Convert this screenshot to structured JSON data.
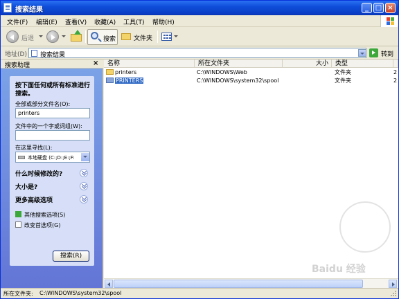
{
  "window": {
    "title": "搜索结果",
    "controls": {
      "minimize": "_",
      "maximize": "□",
      "close": "×"
    }
  },
  "menubar": {
    "items": [
      "文件(F)",
      "编辑(E)",
      "查看(V)",
      "收藏(A)",
      "工具(T)",
      "帮助(H)"
    ]
  },
  "toolbar": {
    "back_label": "后退",
    "search_label": "搜索",
    "folders_label": "文件夹",
    "icons": {
      "back": "back-arrow-icon",
      "forward": "forward-arrow-icon",
      "up": "up-folder-icon",
      "search": "magnifier-icon",
      "folders": "folder-icon",
      "views": "views-grid-icon"
    }
  },
  "address": {
    "label": "地址(D)",
    "value": "搜索结果",
    "go_label": "转到"
  },
  "search_pane": {
    "title": "搜索助理",
    "close": "×",
    "intro": "按下面任何或所有标准进行搜索。",
    "name_label": "全部或部分文件名(O):",
    "name_value": "printers",
    "word_label": "文件中的一个字或词组(W):",
    "word_value": "",
    "look_in_label": "在这里寻找(L):",
    "look_in_value": "本地硬盘 (C:;D:;E:;F:",
    "sections": [
      "什么时候修改的?",
      "大小是?",
      "更多高级选项"
    ],
    "links": [
      "其他搜索选项(S)",
      "改变首选项(G)"
    ],
    "search_button": "搜索(R)"
  },
  "file_list": {
    "columns": [
      "名称",
      "所在文件夹",
      "大小",
      "类型"
    ],
    "rows": [
      {
        "name": "printers",
        "folder": "C:\\WINDOWS\\Web",
        "size": "",
        "type": "文件夹",
        "extra": "2",
        "selected": false
      },
      {
        "name": "PRINTERS",
        "folder": "C:\\WINDOWS\\system32\\spool",
        "size": "",
        "type": "文件夹",
        "extra": "2",
        "selected": true
      }
    ]
  },
  "statusbar": {
    "label": "所在文件夹:",
    "value": "C:\\WINDOWS\\system32\\spool"
  },
  "watermark": "Baidu 经验",
  "colors": {
    "titlebar": "#0a3fc7",
    "selection": "#316ac5",
    "pane_gradient_top": "#7ba2e7",
    "pane_gradient_bottom": "#6375d6"
  }
}
